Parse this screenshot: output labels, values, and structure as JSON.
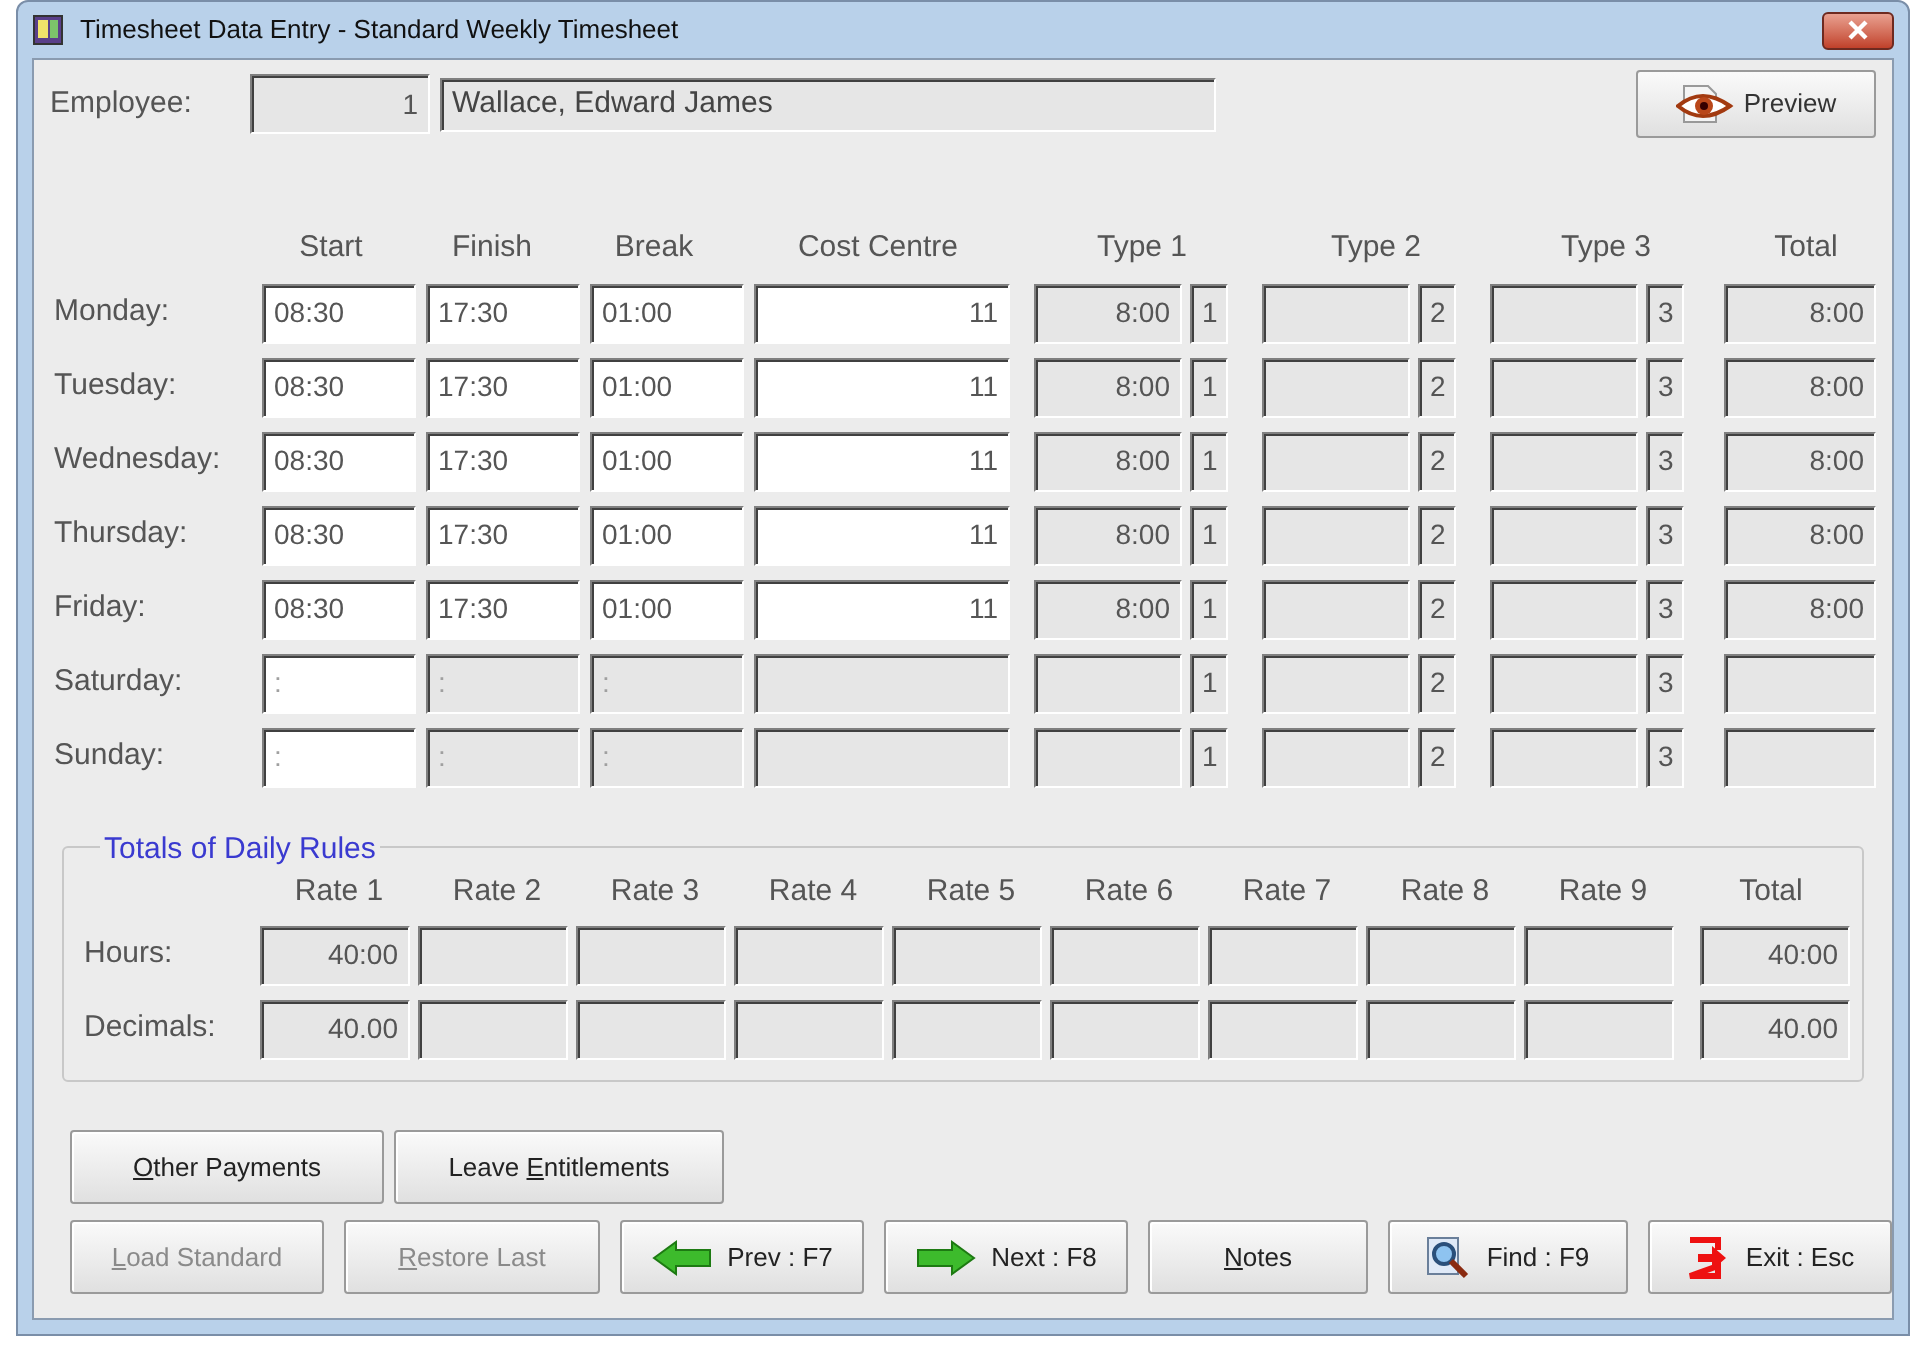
{
  "window": {
    "title": "Timesheet Data Entry - Standard Weekly Timesheet"
  },
  "employee": {
    "label": "Employee:",
    "number": "1",
    "name": "Wallace, Edward James"
  },
  "preview_button": {
    "label": "Preview"
  },
  "columns": [
    "Start",
    "Finish",
    "Break",
    "Cost Centre",
    "Type 1",
    "Type 2",
    "Type 3",
    "Total"
  ],
  "days": [
    {
      "label": "Monday:",
      "start": {
        "value": "08:30",
        "disabled": false
      },
      "finish": {
        "value": "17:30",
        "disabled": false
      },
      "break": {
        "value": "01:00",
        "disabled": false
      },
      "cost_centre": {
        "value": "11",
        "disabled": false
      },
      "type1": "8:00",
      "type1_code": "1",
      "type2_code": "2",
      "type3_code": "3",
      "total": "8:00"
    },
    {
      "label": "Tuesday:",
      "start": {
        "value": "08:30",
        "disabled": false
      },
      "finish": {
        "value": "17:30",
        "disabled": false
      },
      "break": {
        "value": "01:00",
        "disabled": false
      },
      "cost_centre": {
        "value": "11",
        "disabled": false
      },
      "type1": "8:00",
      "type1_code": "1",
      "type2_code": "2",
      "type3_code": "3",
      "total": "8:00"
    },
    {
      "label": "Wednesday:",
      "start": {
        "value": "08:30",
        "disabled": false
      },
      "finish": {
        "value": "17:30",
        "disabled": false
      },
      "break": {
        "value": "01:00",
        "disabled": false
      },
      "cost_centre": {
        "value": "11",
        "disabled": false
      },
      "type1": "8:00",
      "type1_code": "1",
      "type2_code": "2",
      "type3_code": "3",
      "total": "8:00"
    },
    {
      "label": "Thursday:",
      "start": {
        "value": "08:30",
        "disabled": false
      },
      "finish": {
        "value": "17:30",
        "disabled": false
      },
      "break": {
        "value": "01:00",
        "disabled": false
      },
      "cost_centre": {
        "value": "11",
        "disabled": false
      },
      "type1": "8:00",
      "type1_code": "1",
      "type2_code": "2",
      "type3_code": "3",
      "total": "8:00"
    },
    {
      "label": "Friday:",
      "start": {
        "value": "08:30",
        "disabled": false
      },
      "finish": {
        "value": "17:30",
        "disabled": false
      },
      "break": {
        "value": "01:00",
        "disabled": false
      },
      "cost_centre": {
        "value": "11",
        "disabled": false
      },
      "type1": "8:00",
      "type1_code": "1",
      "type2_code": "2",
      "type3_code": "3",
      "total": "8:00"
    },
    {
      "label": "Saturday:",
      "start": {
        "placeholder": ":",
        "disabled": false
      },
      "finish": {
        "placeholder": ":",
        "disabled": true
      },
      "break": {
        "placeholder": ":",
        "disabled": true
      },
      "cost_centre": {
        "disabled": true
      },
      "type1_code": "1",
      "type2_code": "2",
      "type3_code": "3"
    },
    {
      "label": "Sunday:",
      "start": {
        "placeholder": ":",
        "disabled": false
      },
      "finish": {
        "placeholder": ":",
        "disabled": true
      },
      "break": {
        "placeholder": ":",
        "disabled": true
      },
      "cost_centre": {
        "disabled": true
      },
      "type1_code": "1",
      "type2_code": "2",
      "type3_code": "3"
    }
  ],
  "totals": {
    "title": "Totals of Daily Rules",
    "columns": [
      "Rate 1",
      "Rate 2",
      "Rate 3",
      "Rate 4",
      "Rate 5",
      "Rate 6",
      "Rate 7",
      "Rate 8",
      "Rate 9",
      "Total"
    ],
    "rows": [
      {
        "label": "Hours:",
        "rate1": "40:00",
        "total": "40:00"
      },
      {
        "label": "Decimals:",
        "rate1": "40.00",
        "total": "40.00"
      }
    ]
  },
  "buttons_row1": [
    {
      "parts": [
        {
          "text": "O",
          "underlined": true
        },
        {
          "text": "ther Payments",
          "underlined": false
        }
      ],
      "disabled": false
    },
    {
      "parts": [
        {
          "text": "Leave ",
          "underlined": false
        },
        {
          "text": "E",
          "underlined": true
        },
        {
          "text": "ntitlements",
          "underlined": false
        }
      ],
      "disabled": false
    }
  ],
  "buttons_row2": [
    {
      "parts": [
        {
          "text": "L",
          "underlined": true
        },
        {
          "text": "oad Standard",
          "underlined": false
        }
      ],
      "disabled": true
    },
    {
      "parts": [
        {
          "text": "R",
          "underlined": true
        },
        {
          "text": "estore Last",
          "underlined": false
        }
      ],
      "disabled": true
    },
    {
      "parts": [
        {
          "text": "Prev : F7",
          "underlined": false
        }
      ],
      "disabled": false
    },
    {
      "parts": [
        {
          "text": "Next : F8",
          "underlined": false
        }
      ],
      "disabled": false
    },
    {
      "parts": [
        {
          "text": "N",
          "underlined": true
        },
        {
          "text": "otes",
          "underlined": false
        }
      ],
      "disabled": false
    },
    {
      "parts": [
        {
          "text": "Find : F9",
          "underlined": false
        }
      ],
      "disabled": false
    },
    {
      "parts": [
        {
          "text": "Exit : Esc",
          "underlined": false
        }
      ],
      "disabled": false
    }
  ]
}
